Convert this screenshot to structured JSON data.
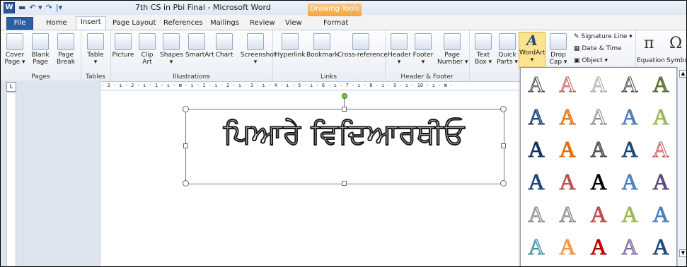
{
  "window": {
    "title": "7th CS in Pbi Final  -  Microsoft Word",
    "context_tab": "Drawing Tools",
    "qat_icons": [
      "word-app-icon",
      "save-icon",
      "undo-icon",
      "redo-icon",
      "customize-icon"
    ]
  },
  "tabs": [
    "File",
    "Home",
    "Insert",
    "Page Layout",
    "References",
    "Mailings",
    "Review",
    "View",
    "Format"
  ],
  "active_tab": "Insert",
  "ribbon": {
    "pages": {
      "label": "Pages",
      "buttons": [
        "Cover\nPage ▾",
        "Blank\nPage",
        "Page\nBreak"
      ]
    },
    "tables": {
      "label": "Tables",
      "buttons": [
        "Table\n▾"
      ]
    },
    "illustrations": {
      "label": "Illustrations",
      "buttons": [
        "Picture",
        "Clip\nArt",
        "Shapes\n▾",
        "SmartArt",
        "Chart",
        "Screenshot\n▾"
      ]
    },
    "links": {
      "label": "Links",
      "buttons": [
        "Hyperlink",
        "Bookmark",
        "Cross-reference"
      ]
    },
    "header_footer": {
      "label": "Header & Footer",
      "buttons": [
        "Header\n▾",
        "Footer\n▾",
        "Page\nNumber ▾"
      ]
    },
    "text": {
      "buttons": [
        "Text\nBox ▾",
        "Quick\nParts ▾",
        "WordArt\n▾",
        "Drop\nCap ▾"
      ],
      "small": [
        "Signature Line ▾",
        "Date & Time",
        "Object ▾"
      ]
    },
    "symbols": {
      "buttons": [
        "Equation",
        "Symbol"
      ],
      "glyphs": [
        "π",
        "Ω"
      ]
    }
  },
  "ruler_text": "· 3 · ı · 2 · ı · 1 · ı · ⊠ · ı · 1 · ı · 2 · ı · 3 · ı · 4 · ı · 5 · ı · 6 · ı · 7 · ı · 8 · ı · 9 · ı · 10 · ı · ⊠ ·",
  "document": {
    "wordart_text": "ਪਿਆਰੇ ਵਿਦਿਆਰਥੀਓ"
  },
  "gallery": {
    "letter": "A",
    "rows": [
      [
        "#ffffff",
        "#ffffff",
        "#ffffff",
        "#ffffff",
        "#76923c"
      ],
      [
        "#4f81bd",
        "#f79646",
        "#ffffff",
        "#4f81bd",
        "#9bbb59"
      ],
      [
        "#17365d",
        "#e36c09",
        "#7f7f7f",
        "#1f497d",
        "#ffffff"
      ],
      [
        "#1f497d",
        "#c0504d",
        "#000000",
        "#4f81bd",
        "#5f497a"
      ],
      [
        "#d9d9d9",
        "#d9d9d9",
        "#c0504d",
        "#9bbb59",
        "#4f81bd"
      ],
      [
        "#b7dde8",
        "#f79646",
        "#c00000",
        "#b2a1c7",
        "#1f497d"
      ]
    ],
    "strokes": [
      [
        "#404040",
        "#c0504d",
        "#a6a6a6",
        "#404040",
        "#4f6228"
      ],
      [
        "#17365d",
        "#e36c09",
        "#7f7f7f",
        "#4f81bd",
        "#9bbb59"
      ],
      [
        "#17365d",
        "#e36c09",
        "#404040",
        "#1f497d",
        "#c0504d"
      ],
      [
        "#1f497d",
        "#c0504d",
        "#000000",
        "#4f81bd",
        "#5f497a"
      ],
      [
        "#808080",
        "#808080",
        "#c0504d",
        "#9bbb59",
        "#4f81bd"
      ],
      [
        "#31859b",
        "#f79646",
        "#c00000",
        "#8064a2",
        "#1f497d"
      ]
    ]
  }
}
